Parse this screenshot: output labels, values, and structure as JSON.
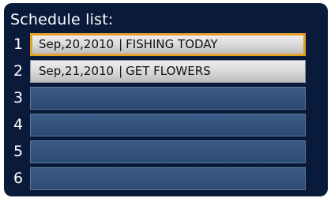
{
  "title": "Schedule list:",
  "rows": [
    {
      "num": "1",
      "date": "Sep,20,2010",
      "separator": "|",
      "text": "FISHING TODAY"
    },
    {
      "num": "2",
      "date": "Sep,21,2010",
      "separator": "|",
      "text": "GET FLOWERS"
    },
    {
      "num": "3"
    },
    {
      "num": "4"
    },
    {
      "num": "5"
    },
    {
      "num": "6"
    }
  ],
  "colors": {
    "screen_background": "#0a1a3a",
    "empty_row": "#34527c",
    "filled_row": "#d9d9d9",
    "selection_highlight": "#e4a12a"
  }
}
